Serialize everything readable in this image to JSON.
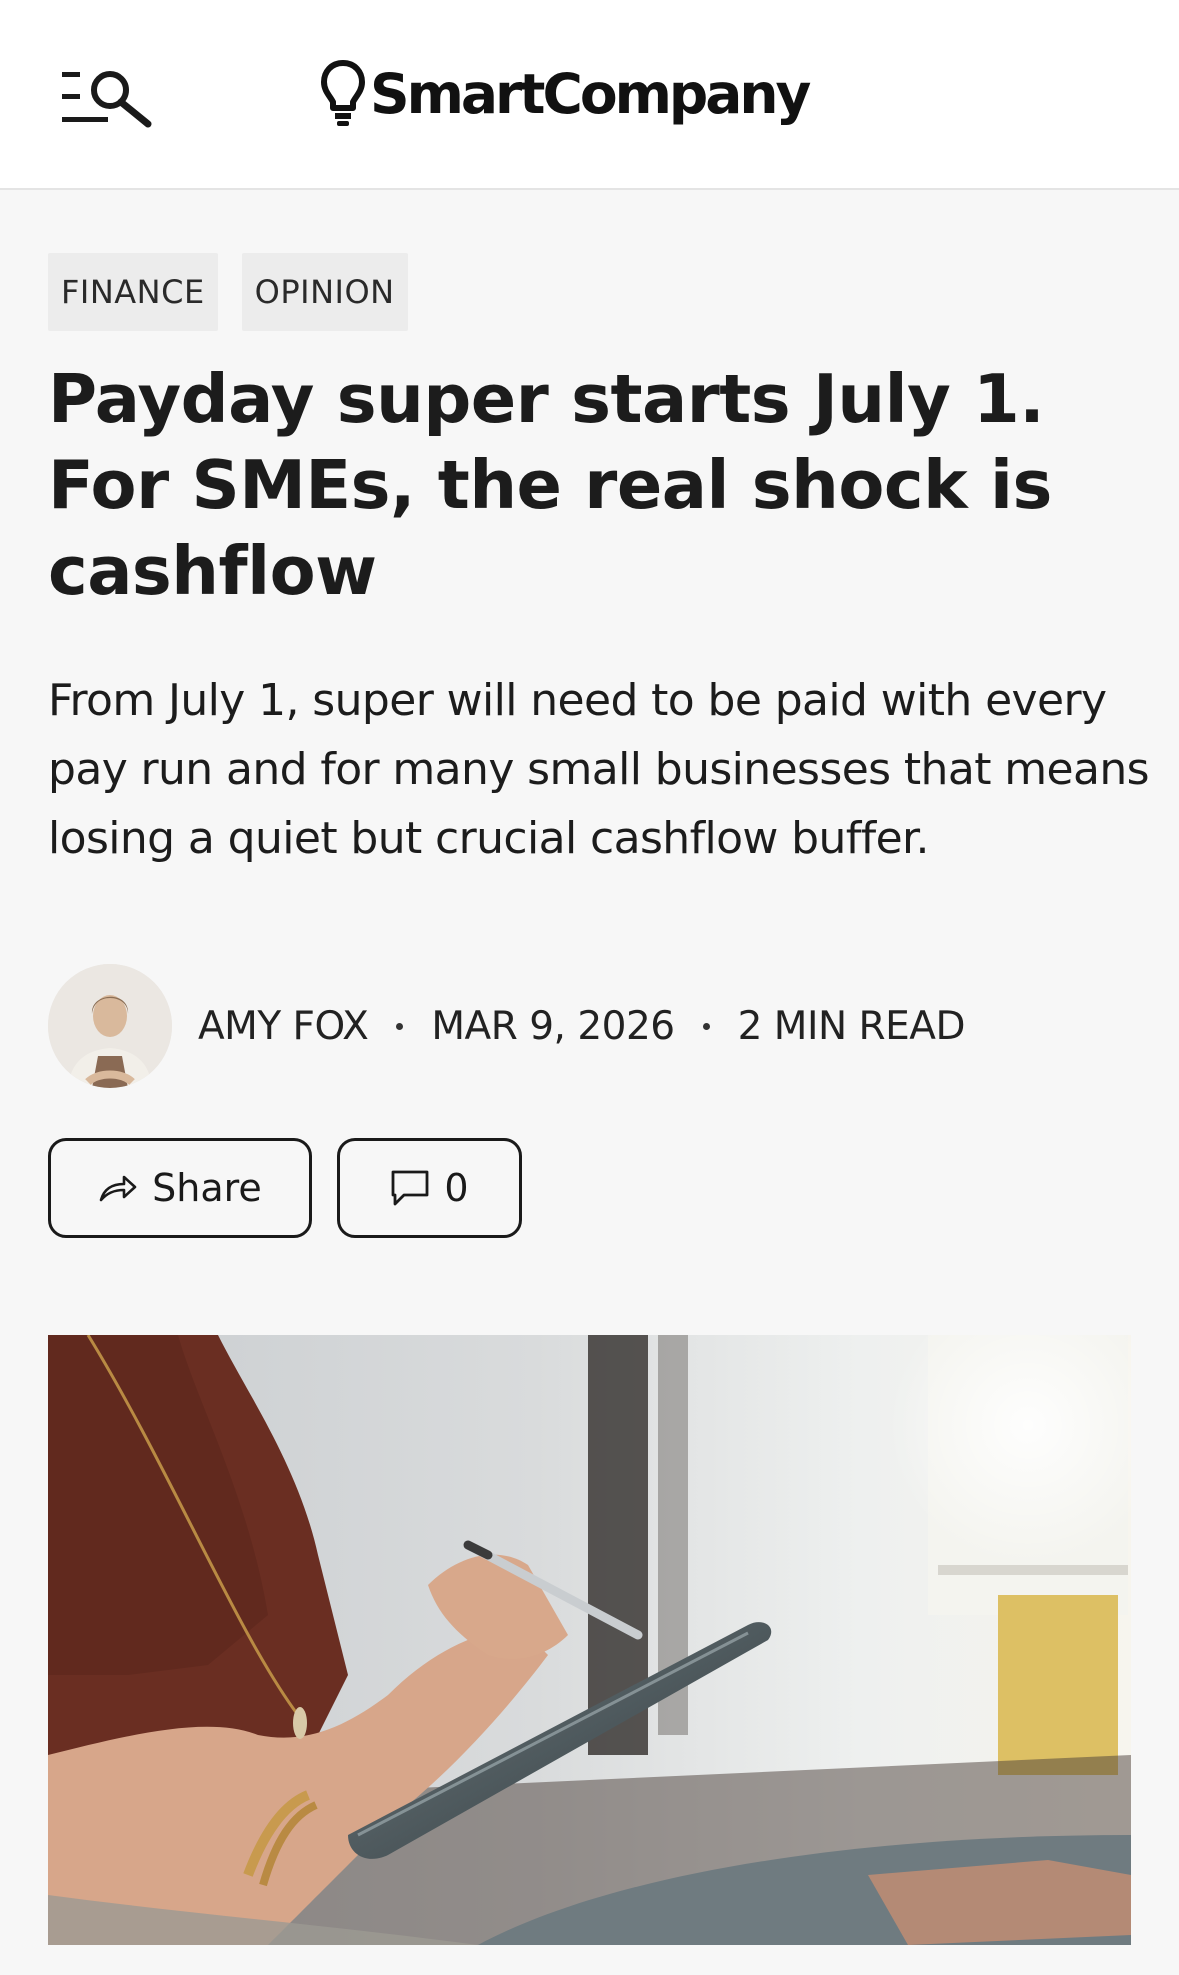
{
  "header": {
    "logo_text": "SmartCompany",
    "icons": [
      "menu-search-icon",
      "lightbulb-logo-icon"
    ]
  },
  "article": {
    "tags": [
      "FINANCE",
      "OPINION"
    ],
    "headline": "Payday super starts July 1. For SMEs, the real shock is cashflow",
    "standfirst": "From July 1, super will need to be paid with every pay run and for many small businesses that means losing a quiet but crucial cashflow buffer.",
    "author": "AMY FOX",
    "date": "MAR 9, 2026",
    "read_time": "2 MIN READ"
  },
  "actions": {
    "share_label": "Share",
    "comment_count": "0",
    "icons": [
      "share-arrow-icon",
      "comment-bubble-icon"
    ]
  },
  "colors": {
    "background": "#f7f7f7",
    "header_bg": "#ffffff",
    "tag_bg": "#ececec",
    "text": "#1a1a1a"
  }
}
